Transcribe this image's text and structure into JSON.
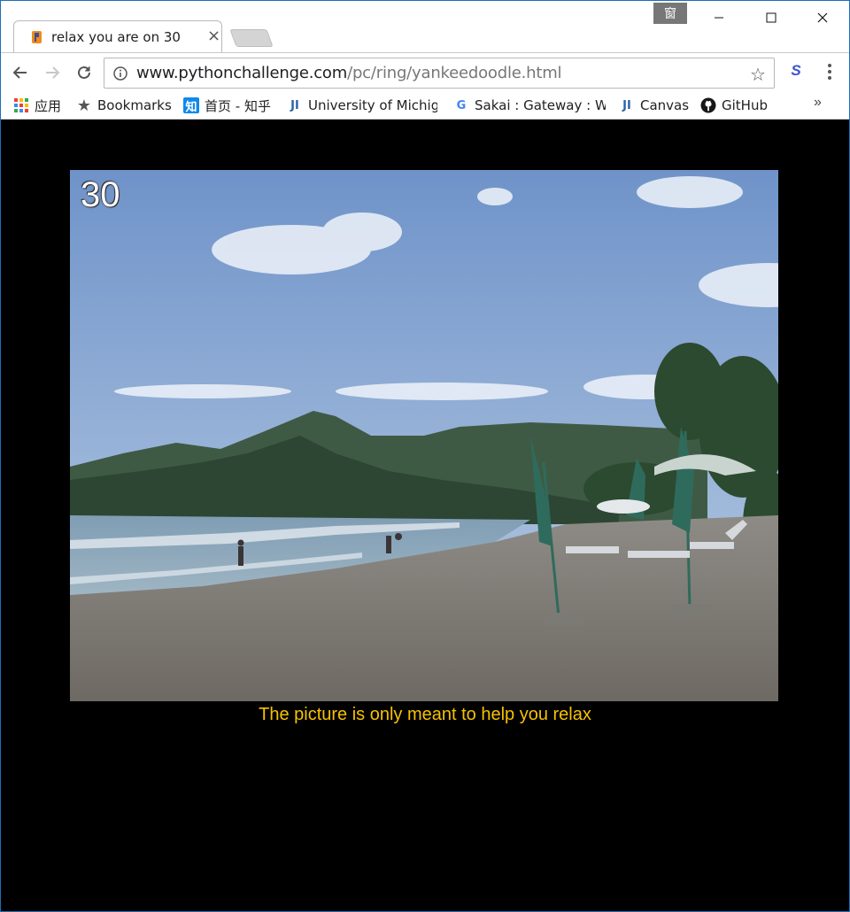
{
  "browser": {
    "tab": {
      "title": "relax you are on 30",
      "close_glyph": "×"
    },
    "ime_badge": "窗",
    "address": {
      "host": "www.pythonchallenge.com",
      "path": "/pc/ring/yankeedoodle.html"
    },
    "bookmarks": [
      {
        "label": "应用",
        "icon": "apps-grid-icon"
      },
      {
        "label": "Bookmarks",
        "icon": "star-icon"
      },
      {
        "label": "首页 - 知乎",
        "icon": "zhihu-icon",
        "icon_text": "知"
      },
      {
        "label": "University of Michig",
        "icon": "ji-icon",
        "icon_text": "JI"
      },
      {
        "label": "Sakai : Gateway : We",
        "icon": "google-icon",
        "icon_text": "G"
      },
      {
        "label": "Canvas",
        "icon": "ji-icon",
        "icon_text": "JI"
      },
      {
        "label": "GitHub",
        "icon": "github-icon"
      }
    ],
    "more_glyph": "»"
  },
  "page": {
    "level_number": "30",
    "caption": "The picture is only meant to help you relax"
  },
  "colors": {
    "background": "#000000",
    "caption": "#f6c200",
    "window_border": "#1c6fb8"
  }
}
